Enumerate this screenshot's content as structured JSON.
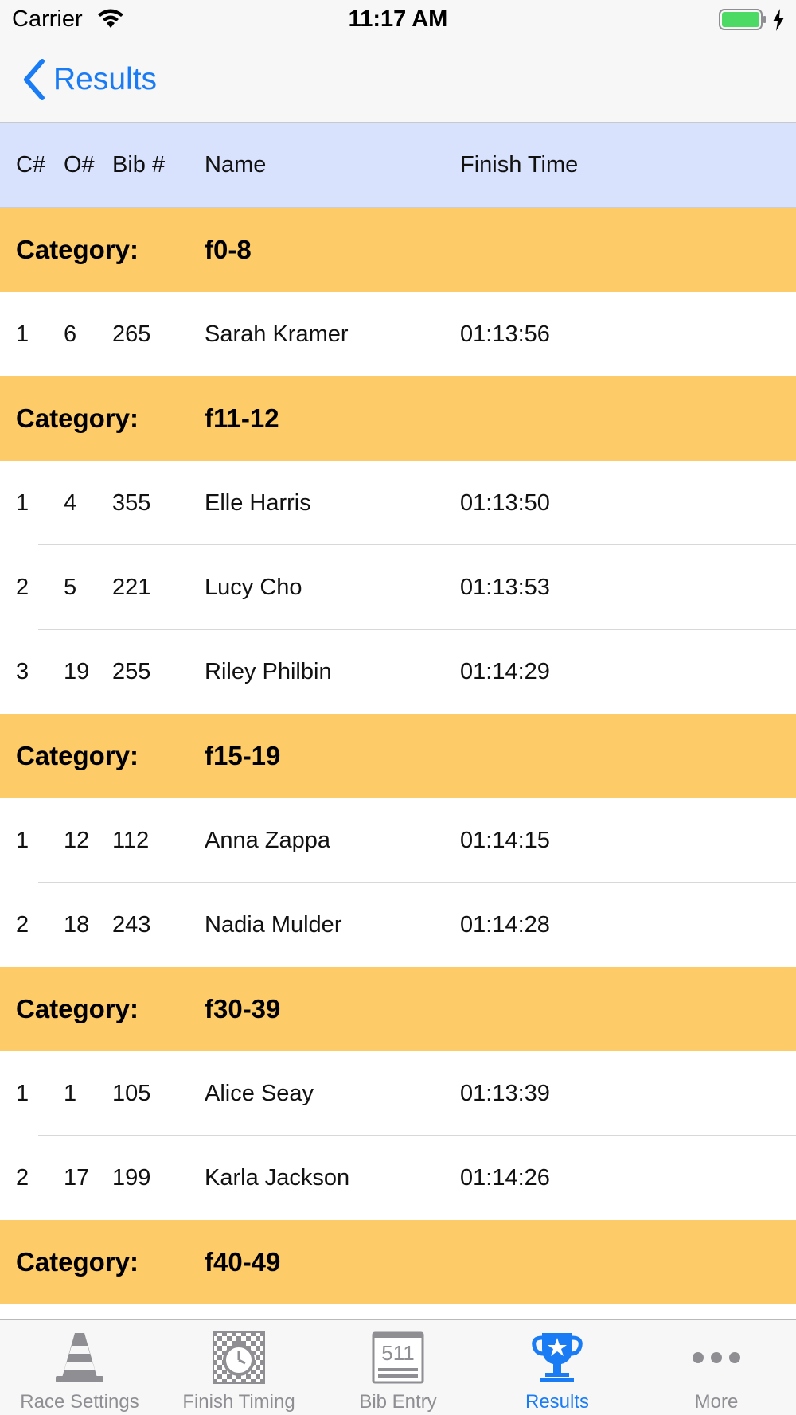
{
  "status_bar": {
    "carrier": "Carrier",
    "time": "11:17 AM",
    "battery_color": "#4cd964"
  },
  "nav": {
    "back_label": "Results",
    "accent_color": "#1a7cf5"
  },
  "columns": {
    "c": "C#",
    "o": "O#",
    "bib": "Bib #",
    "name": "Name",
    "time": "Finish Time"
  },
  "category_label": "Category:",
  "category_color": "#fdcb67",
  "header_color": "#d8e2fc",
  "rows": [
    {
      "type": "category",
      "label": "Category:",
      "value": "f0-8"
    },
    {
      "type": "entry",
      "c": "1",
      "o": "6",
      "bib": "265",
      "name": "Sarah Kramer",
      "time": "01:13:56"
    },
    {
      "type": "category",
      "label": "Category:",
      "value": "f11-12"
    },
    {
      "type": "entry",
      "c": "1",
      "o": "4",
      "bib": "355",
      "name": "Elle Harris",
      "time": "01:13:50"
    },
    {
      "type": "entry",
      "c": "2",
      "o": "5",
      "bib": "221",
      "name": "Lucy Cho",
      "time": "01:13:53"
    },
    {
      "type": "entry",
      "c": "3",
      "o": "19",
      "bib": "255",
      "name": "Riley Philbin",
      "time": "01:14:29"
    },
    {
      "type": "category",
      "label": "Category:",
      "value": "f15-19"
    },
    {
      "type": "entry",
      "c": "1",
      "o": "12",
      "bib": "112",
      "name": "Anna Zappa",
      "time": "01:14:15"
    },
    {
      "type": "entry",
      "c": "2",
      "o": "18",
      "bib": "243",
      "name": "Nadia Mulder",
      "time": "01:14:28"
    },
    {
      "type": "category",
      "label": "Category:",
      "value": "f30-39"
    },
    {
      "type": "entry",
      "c": "1",
      "o": "1",
      "bib": "105",
      "name": "Alice Seay",
      "time": "01:13:39"
    },
    {
      "type": "entry",
      "c": "2",
      "o": "17",
      "bib": "199",
      "name": "Karla Jackson",
      "time": "01:14:26"
    },
    {
      "type": "category",
      "label": "Category:",
      "value": "f40-49"
    }
  ],
  "tabs": [
    {
      "label": "Race Settings",
      "icon": "traffic-cone-icon",
      "active": false
    },
    {
      "label": "Finish Timing",
      "icon": "stopwatch-checkered-icon",
      "active": false
    },
    {
      "label": "Bib Entry",
      "icon": "bib-number-icon",
      "active": false
    },
    {
      "label": "Results",
      "icon": "trophy-icon",
      "active": true
    },
    {
      "label": "More",
      "icon": "more-dots-icon",
      "active": false
    }
  ],
  "bib_icon_text": "511"
}
